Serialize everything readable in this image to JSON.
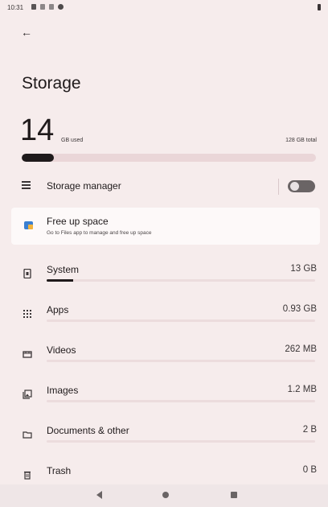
{
  "status": {
    "time": "10:31"
  },
  "header": {
    "title": "Storage"
  },
  "usage": {
    "used_value": "14",
    "used_unit": "GB used",
    "total": "128 GB total",
    "used_fraction": 0.11
  },
  "manager": {
    "label": "Storage manager",
    "enabled": false
  },
  "free_up": {
    "title": "Free up space",
    "subtitle": "Go to Files app to manage and free up space"
  },
  "categories": [
    {
      "name": "System",
      "size": "13 GB",
      "fraction": 0.1,
      "icon": "system-icon"
    },
    {
      "name": "Apps",
      "size": "0.93 GB",
      "fraction": 0.0,
      "icon": "apps-grid-icon"
    },
    {
      "name": "Videos",
      "size": "262 MB",
      "fraction": 0.0,
      "icon": "videos-icon"
    },
    {
      "name": "Images",
      "size": "1.2 MB",
      "fraction": 0.0,
      "icon": "images-icon"
    },
    {
      "name": "Documents & other",
      "size": "2 B",
      "fraction": 0.0,
      "icon": "folder-icon"
    },
    {
      "name": "Trash",
      "size": "0 B",
      "fraction": 0.0,
      "icon": "trash-icon"
    }
  ],
  "colors": {
    "background": "#f6ecec",
    "bar_fill": "#1f1a1b",
    "bar_track": "#ead6d8",
    "accent_blue": "#3a7fd1"
  }
}
